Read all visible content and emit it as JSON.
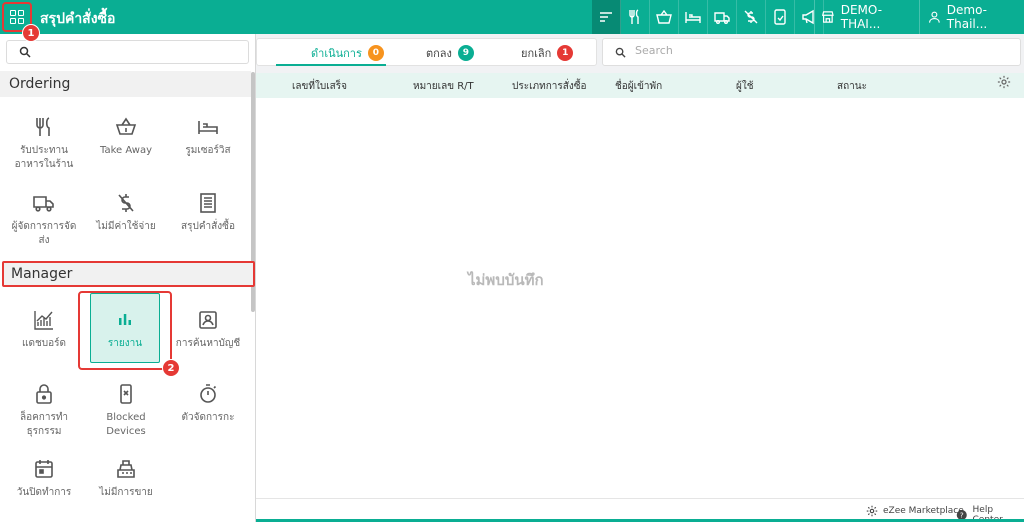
{
  "header": {
    "title": "สรุปคำสั่งซื้อ",
    "property": "DEMO-THAI...",
    "user": "Demo- Thail...",
    "icons": [
      "sort-icon",
      "dine-in-icon",
      "take-away-icon",
      "room-service-icon",
      "delivery-icon",
      "no-charge-icon",
      "mobile-order-icon",
      "announcement-icon",
      "store-icon",
      "user-icon"
    ]
  },
  "annotations": {
    "step1": "1",
    "step2": "2"
  },
  "sidebar": {
    "search_placeholder": "",
    "sections": [
      {
        "title": "Ordering"
      },
      {
        "title": "Manager"
      }
    ],
    "ordering_items": [
      {
        "label": "รับประทาน\nอาหารในร้าน",
        "icon": "fork-knife-icon"
      },
      {
        "label": "Take Away",
        "icon": "basket-icon"
      },
      {
        "label": "รูมเซอร์วิส",
        "icon": "bed-icon"
      },
      {
        "label": "ผู้จัดการการจัด\nส่ง",
        "icon": "truck-icon"
      },
      {
        "label": "ไม่มีค่าใช้จ่าย",
        "icon": "no-dollar-icon"
      },
      {
        "label": "สรุปคำสั่งซื้อ",
        "icon": "receipt-icon"
      }
    ],
    "manager_items": [
      {
        "label": "แดชบอร์ด",
        "icon": "line-chart-icon"
      },
      {
        "label": "รายงาน",
        "icon": "bar-chart-icon",
        "selected": true
      },
      {
        "label": "การค้นหาบัญชี",
        "icon": "account-card-icon"
      },
      {
        "label": "ล็อคการทำ\nธุรกรรม",
        "icon": "lock-icon"
      },
      {
        "label": "Blocked\nDevices",
        "icon": "blocked-device-icon"
      },
      {
        "label": "ตัวจัดการกะ",
        "icon": "stopwatch-icon"
      },
      {
        "label": "วันปิดทำการ",
        "icon": "calendar-icon"
      },
      {
        "label": "ไม่มีการขาย",
        "icon": "cash-register-icon"
      }
    ]
  },
  "tabs": [
    {
      "label": "ดำเนินการ",
      "count": "0",
      "color": "#f7931e"
    },
    {
      "label": "ตกลง",
      "count": "9",
      "color": "#0aae93"
    },
    {
      "label": "ยกเลิก",
      "count": "1",
      "color": "#e53935"
    }
  ],
  "search": {
    "placeholder": "Search"
  },
  "table": {
    "columns": [
      "เลขที่ใบเสร็จ",
      "หมายเลข R/T",
      "ประเภทการสั่งซื้อ",
      "ชื่อผู้เข้าพัก",
      "ผู้ใช้",
      "สถานะ"
    ],
    "empty_text": "ไม่พบบันทึก"
  },
  "footer": {
    "marketplace": "eZee Marketplace",
    "help": "Help Center"
  },
  "colors": {
    "brand": "#0aae93",
    "brand_dark": "#078a74",
    "highlight": "#e53935"
  }
}
